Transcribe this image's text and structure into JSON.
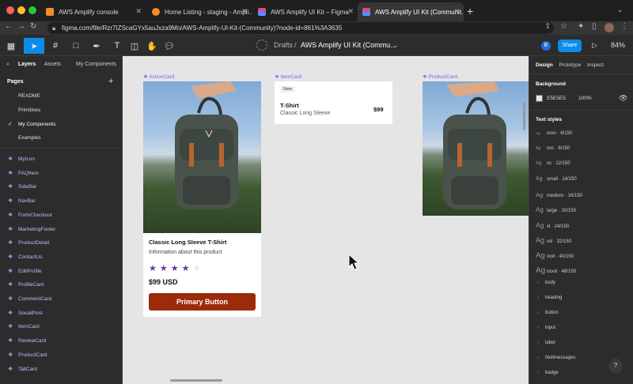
{
  "browser": {
    "tabs": [
      {
        "title": "AWS Amplify console",
        "active": false
      },
      {
        "title": "Home Listing - staging - Ampli...",
        "active": false
      },
      {
        "title": "AWS Amplify UI Kit – Figma",
        "active": false
      },
      {
        "title": "AWS Amplify UI Kit (Communit...",
        "active": true
      }
    ],
    "url": "figma.com/file/Rzr7IZScaGYx5auJxza9Mn/AWS-Amplify-UI-Kit-(Community)?node-id=861%3A3635"
  },
  "toolbar": {
    "breadcrumb_root": "Drafts",
    "breadcrumb_sep": "/",
    "file_name": "AWS Amplify UI Kit (Commu...",
    "user_initial": "B",
    "share_label": "Share",
    "zoom": "84%"
  },
  "left_panel": {
    "tabs": [
      "Layers",
      "Assets"
    ],
    "page_selector": "My Components",
    "pages_heading": "Pages",
    "add_page": "+",
    "pages": [
      {
        "label": "README",
        "current": false
      },
      {
        "label": "Primitives",
        "current": false
      },
      {
        "label": "My Components",
        "current": true
      },
      {
        "label": "Examples",
        "current": false
      }
    ],
    "components": [
      "MyIcon",
      "FAQItem",
      "SideBar",
      "NavBar",
      "FormCheckout",
      "MarketingFooter",
      "ProductDetail",
      "ContactUs",
      "EditProfile",
      "ProfileCard",
      "CommentCard",
      "SocialPost",
      "ItemCard",
      "ReviewCard",
      "ProductCard",
      "TallCard"
    ]
  },
  "canvas": {
    "frames": {
      "action_card": "ActionCard",
      "item_card": "ItemCard",
      "product_card": "ProductCard"
    },
    "action_card": {
      "title": "Classic Long Sleeve T-Shirt",
      "description": "Information about this product",
      "rating": 4,
      "rating_max": 5,
      "price": "$99 USD",
      "button_label": "Primary Button",
      "button_color": "#9c2b0a"
    },
    "item_card": {
      "badge": "New",
      "title": "T-Shirt",
      "subtitle": "Classic Long Sleeve",
      "price": "$99"
    }
  },
  "right_panel": {
    "tabs": [
      "Design",
      "Prototype",
      "Inspect"
    ],
    "background_heading": "Background",
    "background_hex": "E5E5E5",
    "background_opacity": "100%",
    "text_styles_heading": "Text styles",
    "text_styles": [
      {
        "sample": "Ag",
        "name": "xxxs · 6/150"
      },
      {
        "sample": "Ag",
        "name": "xxs · 8/150"
      },
      {
        "sample": "Ag",
        "name": "xs · 12/150"
      },
      {
        "sample": "Ag",
        "name": "small · 14/150"
      },
      {
        "sample": "Ag",
        "name": "medium · 16/150"
      },
      {
        "sample": "Ag",
        "name": "large · 20/150"
      },
      {
        "sample": "Ag",
        "name": "xl · 24/150"
      },
      {
        "sample": "Ag",
        "name": "xxl · 32/150"
      },
      {
        "sample": "Ag",
        "name": "xxxl · 40/150"
      },
      {
        "sample": "Ag",
        "name": "xxxxl · 48/150"
      }
    ],
    "style_groups": [
      "body",
      "heading",
      "button",
      "input",
      "label",
      "fieldmessages",
      "badge"
    ],
    "help": "?"
  },
  "colors": {
    "accent": "#0c8ce9",
    "component_purple": "#7b61ff",
    "star": "#6b2fb3",
    "canvas_bg": "#e5e5e5"
  }
}
